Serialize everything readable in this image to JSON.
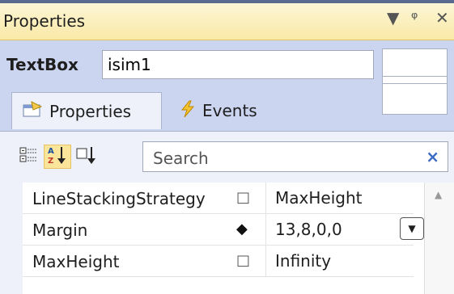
{
  "window": {
    "title": "Properties",
    "controls": [
      "▼",
      "ᵠ",
      "✕"
    ]
  },
  "header": {
    "type_label": "TextBox",
    "name_value": "isim1"
  },
  "tabs": [
    {
      "label": "Properties",
      "icon": "properties-icon"
    },
    {
      "label": "Events",
      "icon": "lightning-icon"
    }
  ],
  "toolbar": {
    "search_placeholder": "Search",
    "clear_glyph": "×"
  },
  "properties": [
    {
      "name": "LineStackingStrategy",
      "marker": "□",
      "value": "MaxHeight"
    },
    {
      "name": "Margin",
      "marker": "◆",
      "value": "13,8,0,0",
      "has_dropdown": true
    },
    {
      "name": "MaxHeight",
      "marker": "□",
      "value": "Infinity"
    }
  ]
}
